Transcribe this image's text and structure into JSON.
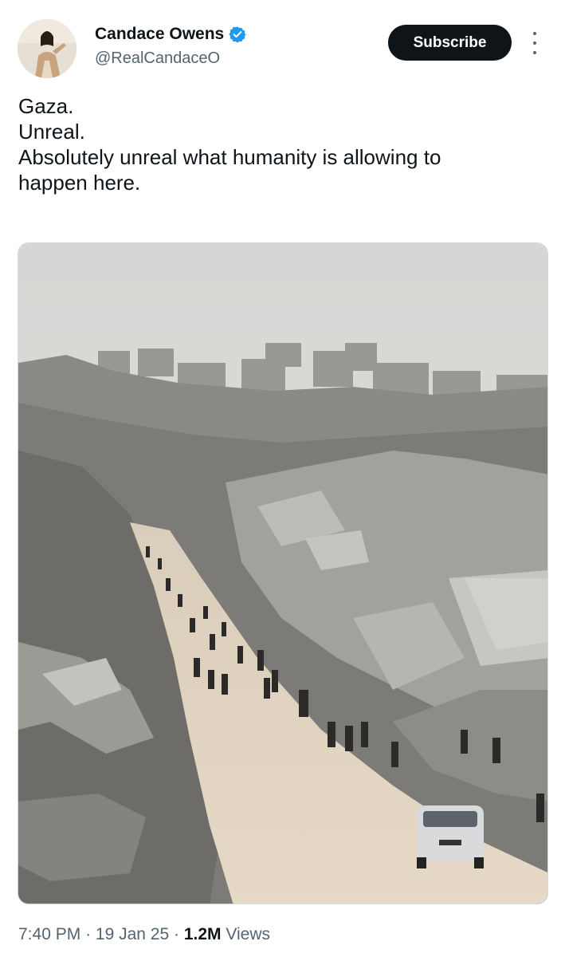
{
  "author": {
    "name": "Candace Owens",
    "handle": "@RealCandaceO",
    "verified_badge_icon": "verified-badge-icon",
    "avatar_description": "avatar"
  },
  "actions": {
    "subscribe_label": "Subscribe",
    "more_icon": "more-options-icon"
  },
  "post": {
    "lines": [
      "Gaza.",
      "Unreal.",
      "Absolutely unreal what humanity is allowing to",
      "happen here."
    ]
  },
  "meta": {
    "time": "7:40 PM",
    "separator": "·",
    "date": "19 Jan 25",
    "views_count": "1.2M",
    "views_label": "Views"
  },
  "colors": {
    "accent": "#1d9bf0",
    "text_primary": "#0f1419",
    "text_secondary": "#536471",
    "button_bg": "#0f1419"
  }
}
